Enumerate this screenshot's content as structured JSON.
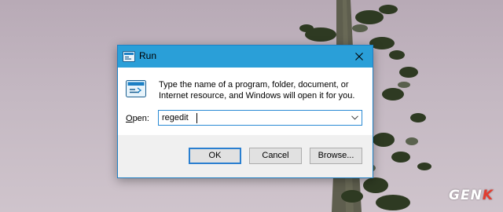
{
  "window": {
    "title": "Run",
    "description": "Type the name of a program, folder, document, or Internet resource, and Windows will open it for you.",
    "open_label_underlined": "O",
    "open_label_rest": "pen:",
    "open_value": "regedit"
  },
  "buttons": {
    "ok": "OK",
    "cancel": "Cancel",
    "browse": "Browse..."
  },
  "icons": {
    "title": "run-icon",
    "body": "run-icon",
    "close": "close-icon",
    "dropdown": "chevron-down-icon"
  },
  "watermark": {
    "text_main": "GEN",
    "text_accent": "K",
    "accent_color": "#e23c2f"
  },
  "colors": {
    "titlebar": "#2a9fd8",
    "focus_border": "#2a7fd0",
    "footer": "#f0f0f0"
  }
}
